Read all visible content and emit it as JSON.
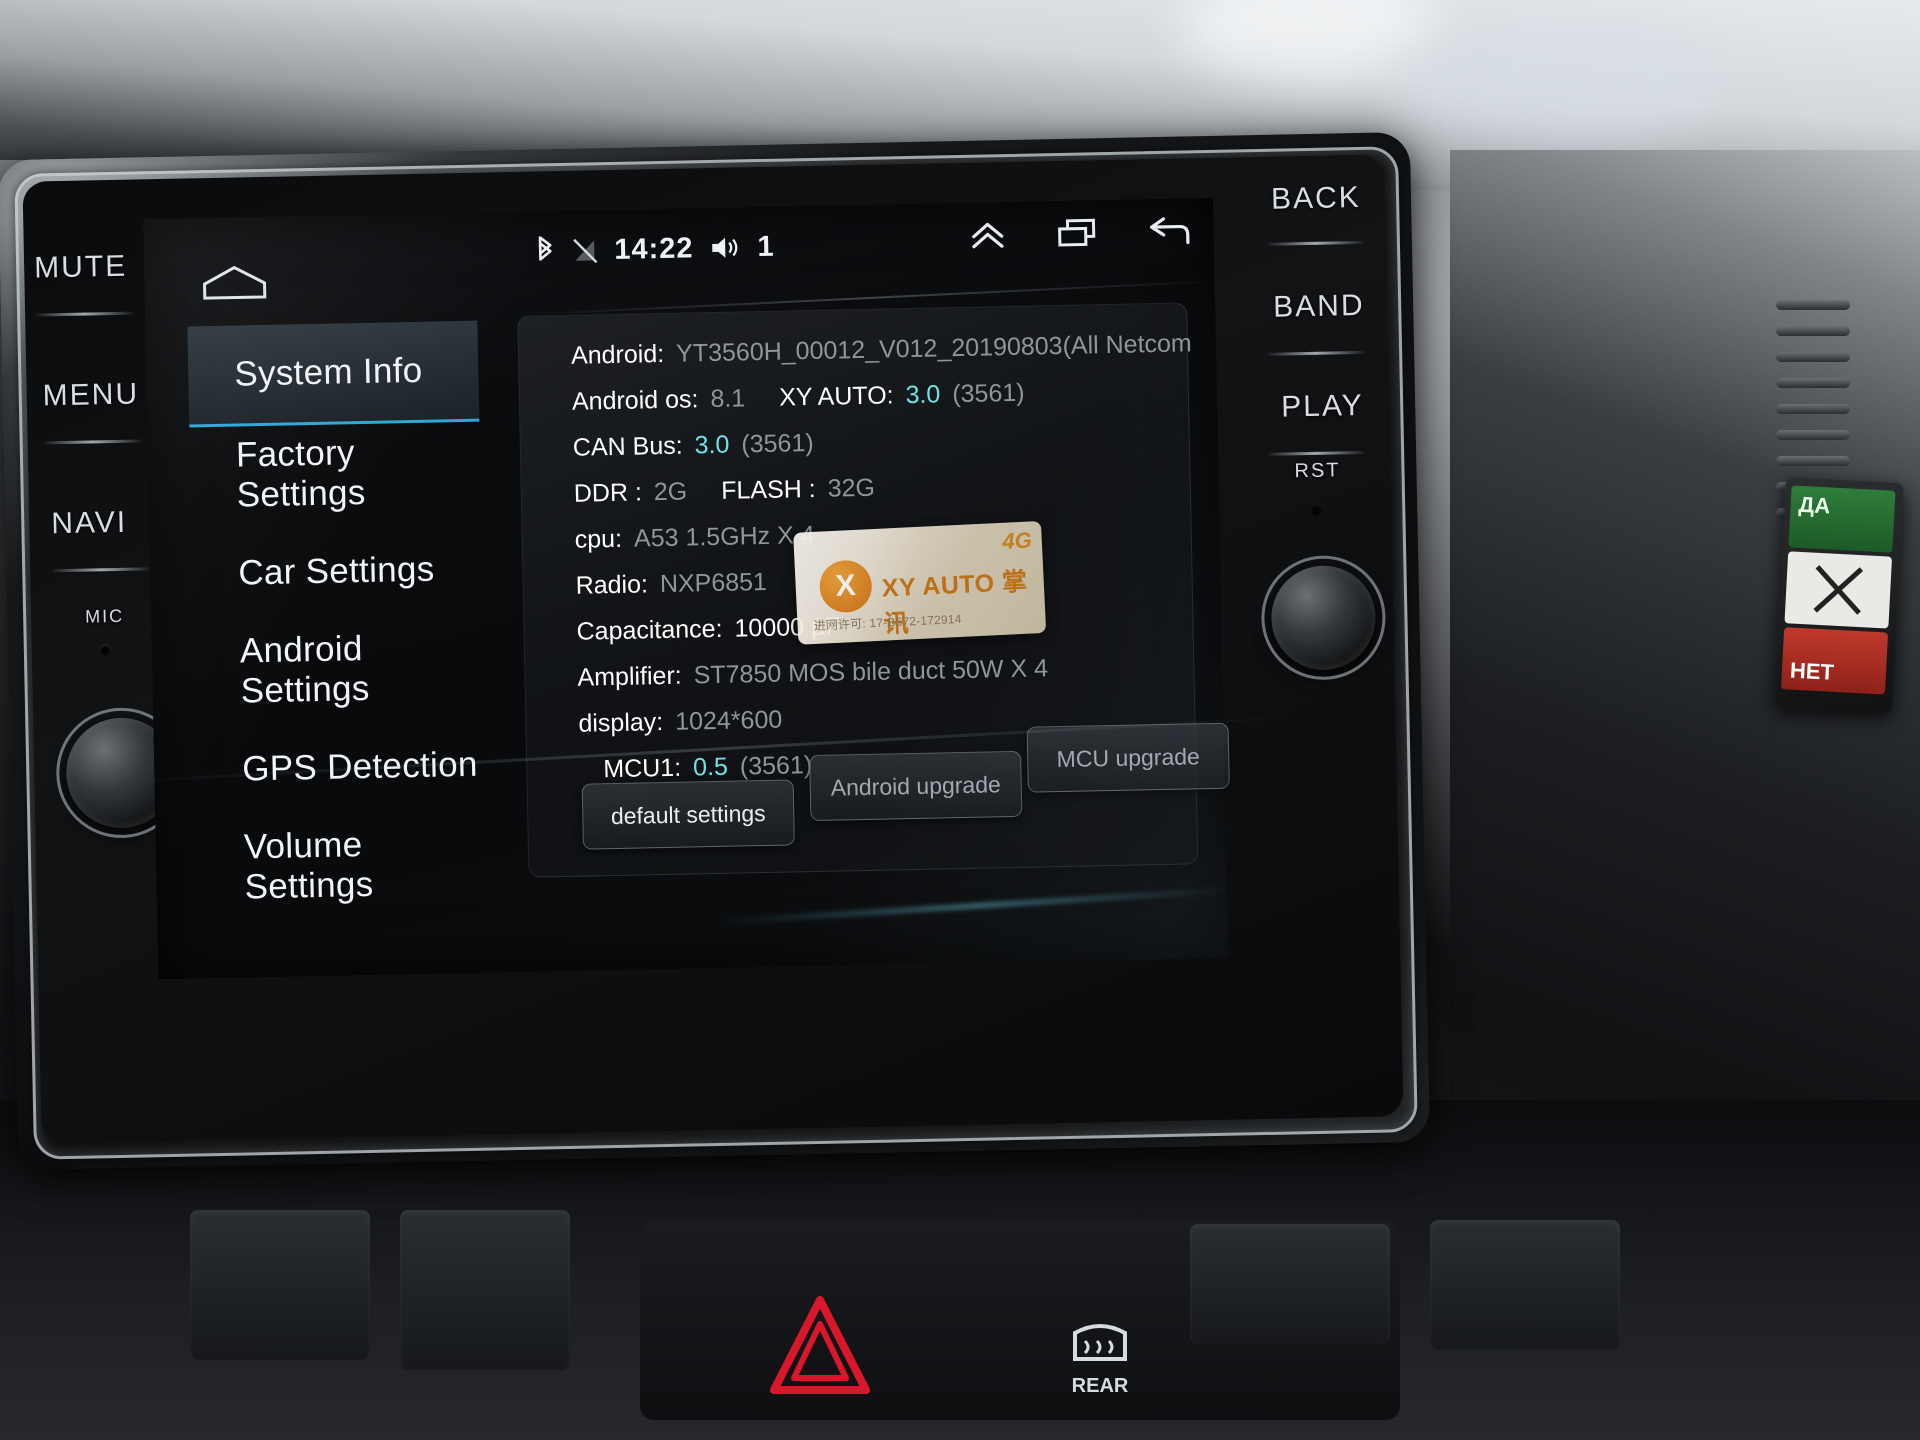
{
  "device": {
    "hard_keys_left": [
      "MUTE",
      "MENU",
      "NAVI"
    ],
    "mic_label": "MIC",
    "hard_keys_right": [
      "BACK",
      "BAND",
      "PLAY",
      "RST"
    ]
  },
  "statusbar": {
    "bluetooth_icon": "bluetooth-icon",
    "signal_off_icon": "signal-off-icon",
    "time": "14:22",
    "volume_icon": "volume-icon",
    "volume_level": "1",
    "nav_up_icon": "double-chevron-up-icon",
    "recents_icon": "recents-icon",
    "back_icon": "back-arrow-icon",
    "home_icon": "home-icon"
  },
  "menu": {
    "items": [
      {
        "label": "System Info",
        "active": true
      },
      {
        "label": "Factory Settings",
        "active": false
      },
      {
        "label": "Car Settings",
        "active": false
      },
      {
        "label": "Android Settings",
        "active": false
      },
      {
        "label": "GPS Detection",
        "active": false
      },
      {
        "label": "Volume Settings",
        "active": false
      }
    ],
    "active_accent": "#2fa8d8"
  },
  "system_info": {
    "rows": [
      {
        "key": "Android:",
        "value": "YT3560H_00012_V012_20190803(All Netcom"
      },
      {
        "key": "Android os:",
        "value": "8.1",
        "key2": "XY AUTO:",
        "value2": "3.0",
        "suffix": "(3561)"
      },
      {
        "key": "CAN Bus:",
        "value": "3.0",
        "suffix": "(3561)"
      },
      {
        "key": "DDR :",
        "value": "2G",
        "key2": "FLASH :",
        "value2": "32G"
      },
      {
        "key": "cpu:",
        "value": "A53 1.5GHz X 4"
      },
      {
        "key": "Radio:",
        "value": "NXP6851"
      },
      {
        "key": "Capacitance:",
        "value": "10000 µF"
      },
      {
        "key": "Amplifier:",
        "value": "ST7850 MOS bile duct 50W X 4"
      },
      {
        "key": "display:",
        "value": "1024*600"
      },
      {
        "key": "MCU1:",
        "value": "0.5",
        "suffix": "(3561)"
      }
    ],
    "buttons": [
      {
        "label": "default settings"
      },
      {
        "label": "Android upgrade"
      },
      {
        "label": "MCU upgrade"
      }
    ]
  },
  "sticker": {
    "badge_4g": "4G",
    "mark": "X",
    "brand": "XY AUTO 掌讯",
    "license": "进网许可: 17-B672-172914"
  },
  "side_device": {
    "green_label": "ДА",
    "red_label": "НЕТ"
  },
  "console": {
    "rear_label": "REAR",
    "hazard_icon": "hazard-triangle-icon",
    "rear_defrost_icon": "rear-defrost-icon"
  }
}
